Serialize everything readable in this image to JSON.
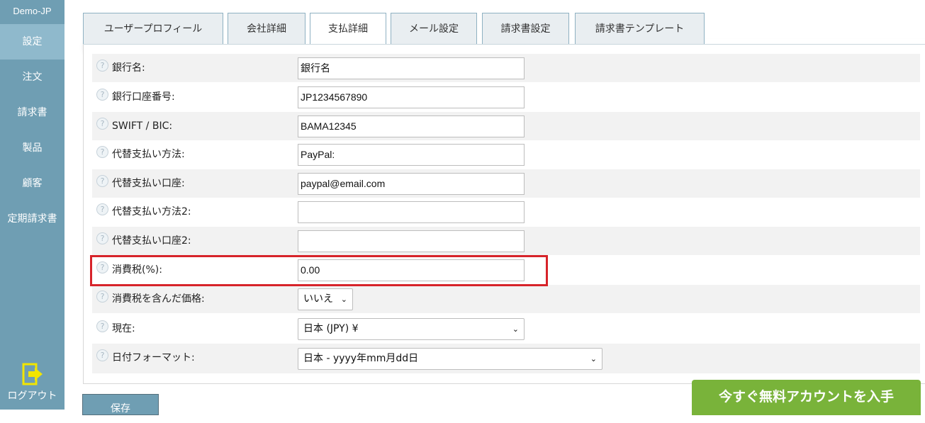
{
  "sidebar": {
    "brand": "Demo-JP",
    "items": [
      {
        "label": "設定",
        "active": true
      },
      {
        "label": "注文"
      },
      {
        "label": "請求書"
      },
      {
        "label": "製品"
      },
      {
        "label": "顧客"
      },
      {
        "label": "定期請求書"
      }
    ],
    "logout_label": "ログアウト"
  },
  "tabs": [
    {
      "label": "ユーザープロフィール"
    },
    {
      "label": "会社詳細"
    },
    {
      "label": "支払詳細",
      "active": true
    },
    {
      "label": "メール設定"
    },
    {
      "label": "請求書設定"
    },
    {
      "label": "請求書テンプレート"
    }
  ],
  "form": {
    "help_glyph": "?",
    "rows": [
      {
        "label": "銀行名:",
        "value": "銀行名"
      },
      {
        "label": "銀行口座番号:",
        "value": "JP1234567890"
      },
      {
        "label": "SWIFT / BIC:",
        "value": "BAMA12345"
      },
      {
        "label": "代替支払い方法:",
        "value": "PayPal:"
      },
      {
        "label": "代替支払い口座:",
        "value": "paypal@email.com"
      },
      {
        "label": "代替支払い方法2:",
        "value": ""
      },
      {
        "label": "代替支払い口座2:",
        "value": ""
      },
      {
        "label": "消費税(%):",
        "value": "0.00"
      },
      {
        "label": "消費税を含んだ価格:",
        "value": "いいえ"
      },
      {
        "label": "現在:",
        "value": "日本 (JPY) ¥"
      },
      {
        "label": "日付フォーマット:",
        "value": "日本 - yyyy年mm月dd日"
      }
    ]
  },
  "buttons": {
    "save_label": "保存",
    "cta_label": "今すぐ無料アカウントを入手"
  },
  "colors": {
    "sidebar": "#6f9eb3",
    "highlight": "#d7232a",
    "cta": "#79b33a"
  }
}
